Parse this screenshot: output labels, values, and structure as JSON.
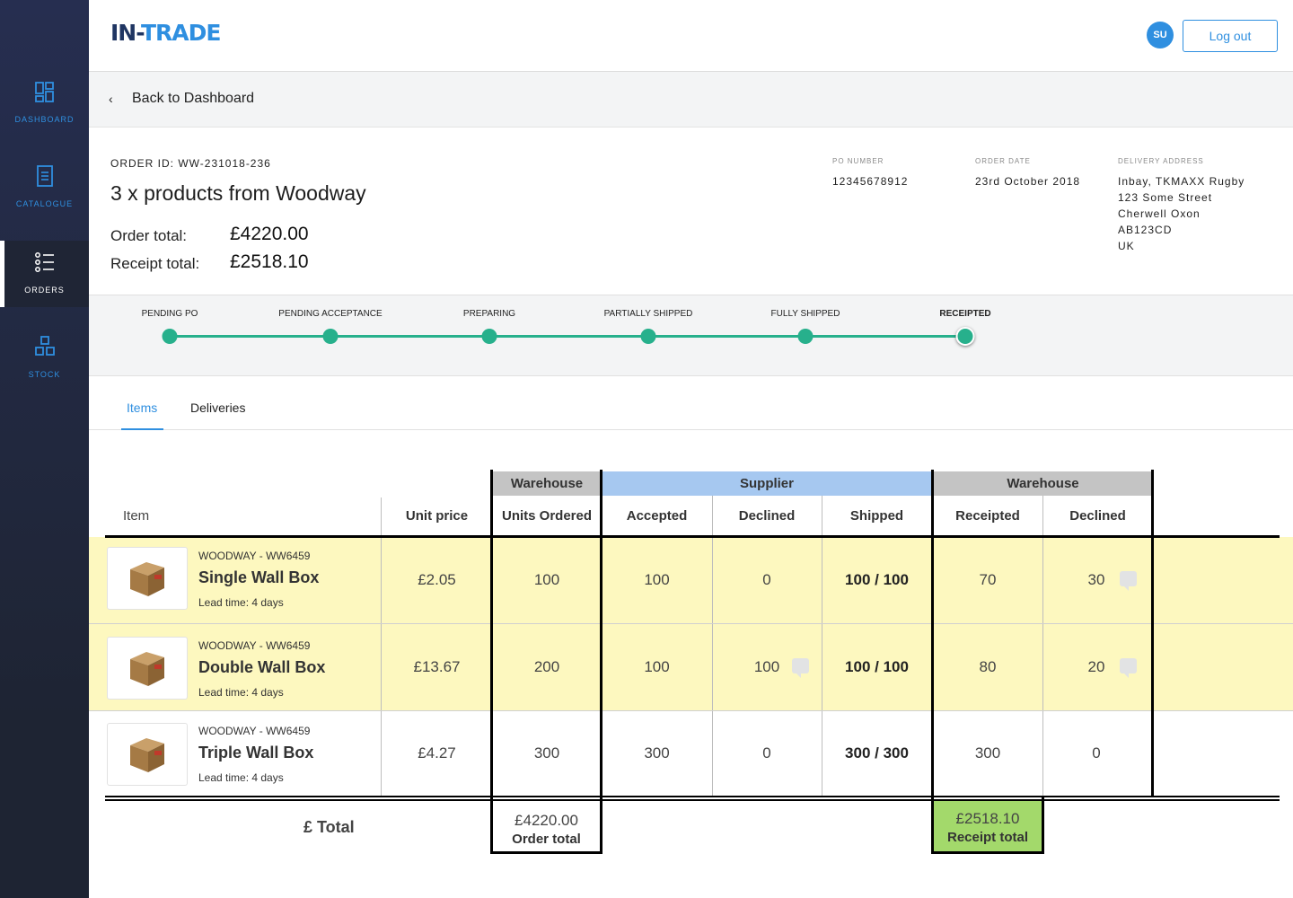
{
  "sidebar": {
    "items": [
      {
        "label": "DASHBOARD",
        "icon": "dashboard-icon"
      },
      {
        "label": "CATALOGUE",
        "icon": "catalogue-icon"
      },
      {
        "label": "ORDERS",
        "icon": "orders-icon",
        "active": true
      },
      {
        "label": "STOCK",
        "icon": "stock-icon"
      }
    ]
  },
  "header": {
    "logo_left": "IN-",
    "logo_right": "TRADE",
    "avatar_initials": "SU",
    "logout_label": "Log out"
  },
  "back": {
    "label": "Back to Dashboard"
  },
  "order": {
    "id_line": "ORDER ID: WW-231018-236",
    "title": "3 x products from Woodway",
    "order_total_label": "Order total:",
    "order_total_value": "£4220.00",
    "receipt_total_label": "Receipt total:",
    "receipt_total_value": "£2518.10",
    "po_number_label": "PO NUMBER",
    "po_number": "12345678912",
    "order_date_label": "ORDER DATE",
    "order_date": "23rd October 2018",
    "delivery_address_label": "DELIVERY ADDRESS",
    "delivery_address": [
      "Inbay, TKMAXX Rugby",
      "123 Some Street",
      "Cherwell Oxon",
      "AB123CD",
      "UK"
    ]
  },
  "progress": {
    "steps": [
      "PENDING PO",
      "PENDING ACCEPTANCE",
      "PREPARING",
      "PARTIALLY SHIPPED",
      "FULLY SHIPPED",
      "RECEIPTED"
    ],
    "current_index": 5,
    "color": "#27b08c"
  },
  "tabs": [
    {
      "label": "Items",
      "active": true
    },
    {
      "label": "Deliveries",
      "active": false
    }
  ],
  "table": {
    "groups": {
      "warehouse_ordered": "Warehouse",
      "supplier": "Supplier",
      "warehouse_received": "Warehouse"
    },
    "columns": {
      "item": "Item",
      "unit_price": "Unit price",
      "units_ordered": "Units Ordered",
      "accepted": "Accepted",
      "declined": "Declined",
      "shipped": "Shipped",
      "receipted": "Receipted",
      "declined2": "Declined"
    },
    "rows": [
      {
        "sku": "WOODWAY - WW6459",
        "name": "Single Wall Box",
        "lead": "Lead time: 4 days",
        "unit_price": "£2.05",
        "units_ordered": "100",
        "accepted": "100",
        "declined": "0",
        "shipped": "100 / 100",
        "receipted": "70",
        "declined2": "30",
        "highlight": true,
        "declined_comment": false,
        "declined2_comment": true
      },
      {
        "sku": "WOODWAY - WW6459",
        "name": "Double Wall Box",
        "lead": "Lead time: 4 days",
        "unit_price": "£13.67",
        "units_ordered": "200",
        "accepted": "100",
        "declined": "100",
        "shipped": "100 / 100",
        "receipted": "80",
        "declined2": "20",
        "highlight": true,
        "declined_comment": true,
        "declined2_comment": true
      },
      {
        "sku": "WOODWAY - WW6459",
        "name": "Triple Wall Box",
        "lead": "Lead time: 4 days",
        "unit_price": "£4.27",
        "units_ordered": "300",
        "accepted": "300",
        "declined": "0",
        "shipped": "300 / 300",
        "receipted": "300",
        "declined2": "0",
        "highlight": false,
        "declined_comment": false,
        "declined2_comment": false
      }
    ],
    "footer": {
      "label": "£ Total",
      "order_total_value": "£4220.00",
      "order_total_label": "Order total",
      "receipt_total_value": "£2518.10",
      "receipt_total_label": "Receipt total"
    }
  },
  "colors": {
    "accent": "#2f8fe0",
    "navy": "#1f3562",
    "highlight_row": "#fdf8bf",
    "supplier_header": "#a6c8f0",
    "warehouse_header": "#c4c4c4",
    "receipt_total_bg": "#a3d96b"
  }
}
